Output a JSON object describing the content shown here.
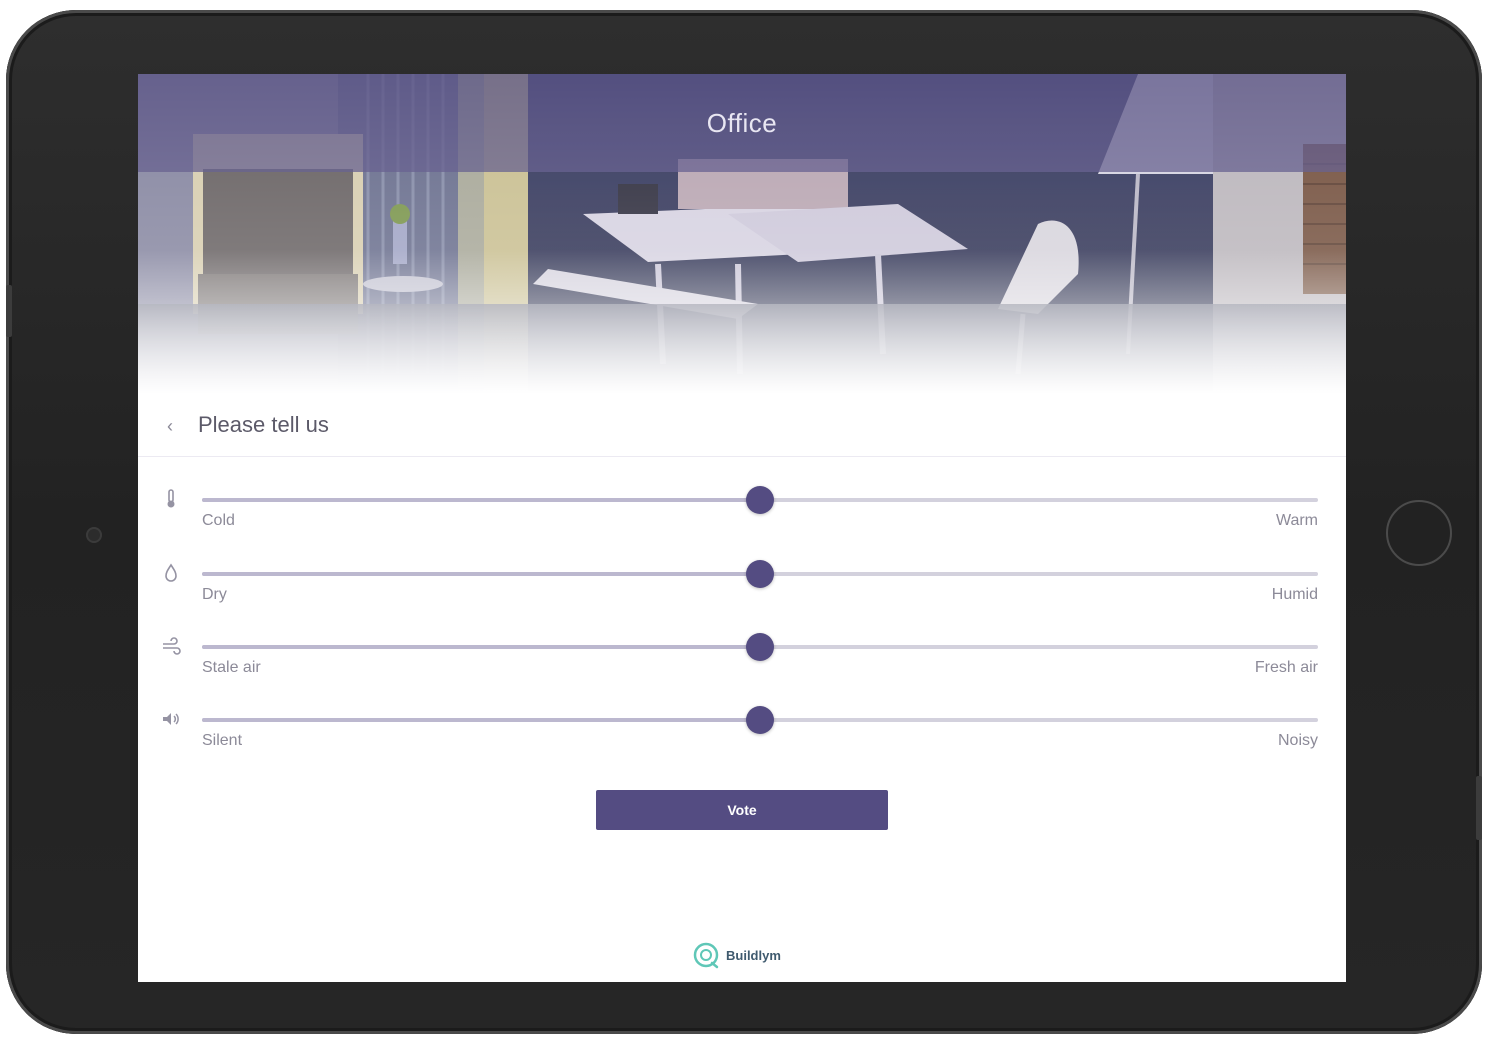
{
  "header": {
    "title": "Office"
  },
  "subheader": {
    "back_icon": "chevron-left-icon",
    "back_label": "‹",
    "title": "Please tell us"
  },
  "sliders": [
    {
      "id": "temperature",
      "icon": "thermometer-icon",
      "min_label": "Cold",
      "max_label": "Warm",
      "value": 0.5
    },
    {
      "id": "humidity",
      "icon": "droplet-icon",
      "min_label": "Dry",
      "max_label": "Humid",
      "value": 0.5
    },
    {
      "id": "air",
      "icon": "wind-icon",
      "min_label": "Stale air",
      "max_label": "Fresh air",
      "value": 0.5
    },
    {
      "id": "noise",
      "icon": "speaker-icon",
      "min_label": "Silent",
      "max_label": "Noisy",
      "value": 0.5
    }
  ],
  "vote": {
    "label": "Vote"
  },
  "brand": {
    "name": "Buildlym",
    "logo_icon": "buildlym-logo-icon"
  },
  "colors": {
    "accent": "#544c82",
    "title_overlay": "#5b5487",
    "device_frame": "#262626"
  }
}
